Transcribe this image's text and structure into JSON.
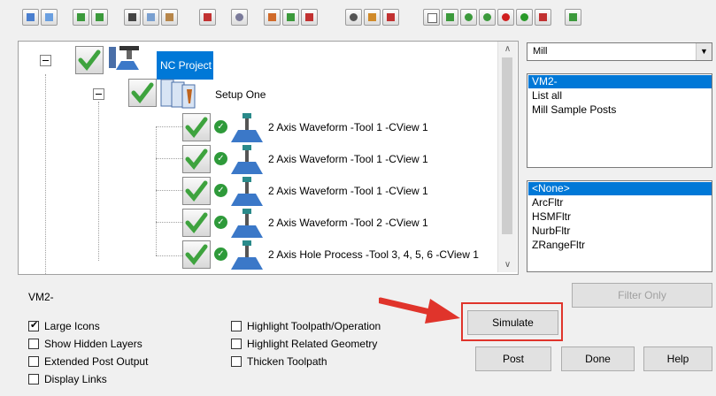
{
  "toolbar": {
    "icons": [
      "select-all-icon",
      "select-icon",
      "group-icon",
      "filter-icon",
      "cut-icon",
      "copy-icon",
      "paste-icon",
      "delete-icon",
      "settings-icon",
      "insert-icon",
      "regen-icon",
      "edit-icon",
      "link-icon",
      "chart-icon",
      "stop-icon",
      "new-file-icon",
      "report-icon",
      "green-ops-icon",
      "green-dot-icon",
      "red-dots-icon",
      "green-dots-icon",
      "nc-file-icon",
      "tools-icon"
    ]
  },
  "tree": {
    "root": {
      "label": "NC Project"
    },
    "setup": {
      "label": "Setup One"
    },
    "operations": [
      {
        "label": "2 Axis Waveform  -Tool 1 -CView 1"
      },
      {
        "label": "2 Axis Waveform  -Tool 1 -CView 1"
      },
      {
        "label": "2 Axis Waveform  -Tool 1 -CView 1"
      },
      {
        "label": "2 Axis Waveform  -Tool 2 -CView 1"
      },
      {
        "label": "2 Axis Hole Process  -Tool 3, 4, 5, 6 -CView 1"
      }
    ]
  },
  "right": {
    "machine_type": "Mill",
    "posts": [
      "VM2-",
      "List all",
      "Mill Sample Posts"
    ],
    "filters": [
      "<None>",
      "ArcFltr",
      "HSMFltr",
      "NurbFltr",
      "ZRangeFltr"
    ]
  },
  "status": {
    "text": "VM2-"
  },
  "options": {
    "left": [
      {
        "label": "Large Icons",
        "checked": true
      },
      {
        "label": "Show Hidden Layers",
        "checked": false
      },
      {
        "label": "Extended Post Output",
        "checked": false
      },
      {
        "label": "Display Links",
        "checked": false
      }
    ],
    "middle": [
      {
        "label": "Highlight Toolpath/Operation",
        "checked": false
      },
      {
        "label": "Highlight Related Geometry",
        "checked": false
      },
      {
        "label": "Thicken Toolpath",
        "checked": false
      }
    ]
  },
  "buttons": {
    "filter_only": "Filter Only",
    "simulate": "Simulate",
    "post": "Post",
    "done": "Done",
    "help": "Help"
  },
  "colors": {
    "selection": "#0078d7",
    "annotation": "#e0342b",
    "check": "#3ea33e"
  }
}
